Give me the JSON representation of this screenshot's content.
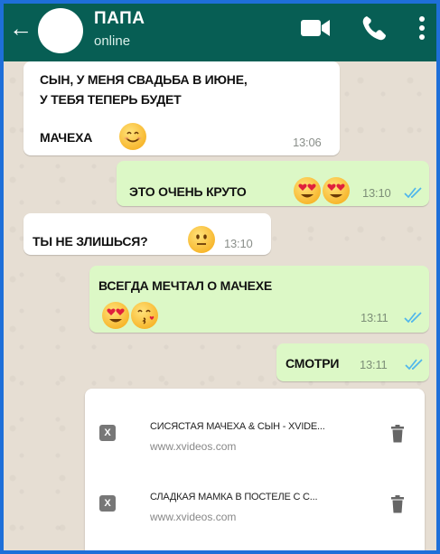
{
  "header": {
    "back_icon": "arrow-left-icon",
    "contact_name": "ПАПА",
    "status": "online",
    "icons": [
      "video-camera-icon",
      "phone-icon",
      "more-vertical-icon"
    ],
    "color": "#075e54"
  },
  "messages": [
    {
      "direction": "incoming",
      "lines": [
        "СЫН, У МЕНЯ СВАДЬБА В ИЮНЕ,",
        "У ТЕБЯ ТЕПЕРЬ БУДЕТ",
        "МАЧЕХА"
      ],
      "emoji": [
        "smiling-face-icon"
      ],
      "time": "13:06"
    },
    {
      "direction": "outgoing",
      "text": "ЭТО ОЧЕНЬ КРУТО",
      "emoji": [
        "heart-eyes-icon",
        "heart-eyes-icon"
      ],
      "time": "13:10",
      "status": "read"
    },
    {
      "direction": "incoming",
      "text": "ТЫ НЕ ЗЛИШЬСЯ?",
      "emoji": [
        "neutral-face-icon"
      ],
      "time": "13:10"
    },
    {
      "direction": "outgoing",
      "text": "ВСЕГДА МЕЧТАЛ О МАЧЕХЕ",
      "emoji": [
        "heart-eyes-icon",
        "kissing-face-icon"
      ],
      "time": "13:11",
      "status": "read"
    },
    {
      "direction": "outgoing",
      "text": "СМОТРИ",
      "time": "13:11",
      "status": "read"
    }
  ],
  "links": [
    {
      "favicon": "X",
      "title": "СИСЯСТАЯ МАЧЕХА & СЫН - XVIDE...",
      "url": "www.xvideos.com",
      "action_icon": "trash-icon"
    },
    {
      "favicon": "X",
      "title": "СЛАДКАЯ МАМКА В ПОСТЕЛЕ С С...",
      "url": "www.xvideos.com",
      "action_icon": "trash-icon"
    }
  ],
  "colors": {
    "incoming": "#ffffff",
    "outgoing": "#dcf8c6",
    "read_ticks": "#4fb6ec",
    "frame": "#1e6fd9"
  }
}
